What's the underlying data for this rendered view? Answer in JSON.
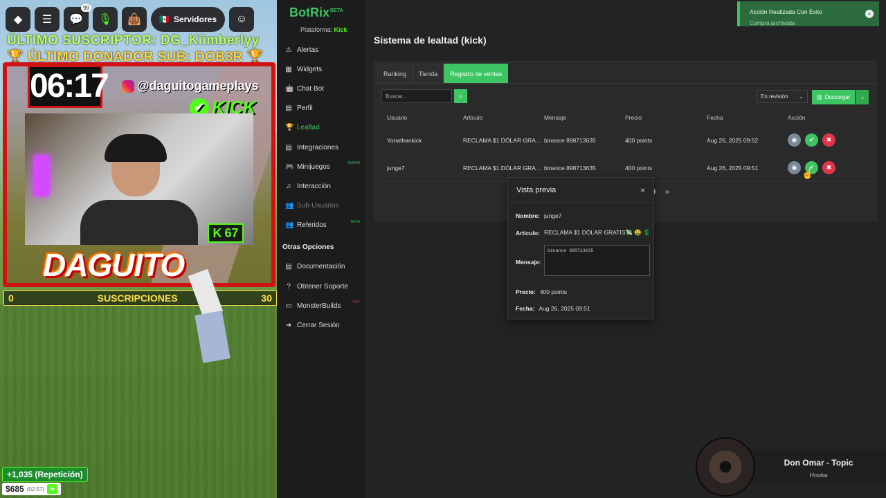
{
  "stream": {
    "topbar": {
      "chat_badge": "99",
      "servers_label": "Servidores"
    },
    "ticker_sub": "ÚLTIMO SUSCRIPTOR: DG_Kiimberlyy",
    "ticker_donor": "🏆 ÚLTIMO DONADOR SUB: DOB3R 🏆",
    "timer": "06:17",
    "instagram": "@daguitogameplays",
    "kick_label": "KICK",
    "kick_count": "67",
    "streamer_name": "DAGUITO",
    "sub_goal": {
      "label": "SUSCRIPCIONES",
      "start": "0",
      "end": "30"
    },
    "repeat": "+1,035 (Repetición)",
    "money": "$685",
    "money_time": "(02:57)",
    "money_plus": "+"
  },
  "app": {
    "logo": "BotRix",
    "logo_tag": "BETA",
    "platform_label": "Plataforma:",
    "platform_value": "Kick",
    "nav": [
      {
        "label": "Alertas",
        "icon": "⚠"
      },
      {
        "label": "Widgets",
        "icon": "▦"
      },
      {
        "label": "Chat Bot",
        "icon": "🤖"
      },
      {
        "label": "Perfil",
        "icon": "▤"
      },
      {
        "label": "Lealtad",
        "icon": "🏆"
      },
      {
        "label": "Integraciones",
        "icon": "▤"
      },
      {
        "label": "Minijuegos",
        "icon": "🎮",
        "tag": "NUEVO"
      },
      {
        "label": "Interacción",
        "icon": "♫"
      },
      {
        "label": "Sub-Usuarios",
        "icon": "👥"
      },
      {
        "label": "Referidos",
        "icon": "👥",
        "tag": "BETA"
      }
    ],
    "other_section": "Otras Opciones",
    "other_nav": [
      {
        "label": "Documentación",
        "icon": "▤"
      },
      {
        "label": "Obtener Soporte",
        "icon": "?"
      },
      {
        "label": "MonsterBuilds",
        "icon": "▭",
        "tag": "HOT"
      },
      {
        "label": "Cerrar Sesión",
        "icon": "➜"
      }
    ],
    "page_title": "Sistema de lealtad (kick)",
    "tabs": [
      "Ranking",
      "Tienda",
      "Registro de ventas"
    ],
    "search_placeholder": "Buscar...",
    "filter_value": "En revisión",
    "download_label": "Descargar",
    "columns": [
      "Usuario",
      "Articulo",
      "Mensaje",
      "Precio",
      "Fecha",
      "Acción"
    ],
    "rows": [
      {
        "user": "Yonathankick",
        "item": "RECLAMA $1 DÓLAR GRA...",
        "message": "binance 898713635",
        "price": "400 points",
        "date": "Aug 26, 2025 09:52"
      },
      {
        "user": "junge7",
        "item": "RECLAMA $1 DÓLAR GRA...",
        "message": "binance 898713635",
        "price": "400 points",
        "date": "Aug 26, 2025 09:51"
      }
    ],
    "pager": {
      "next": "»"
    },
    "modal": {
      "title": "Vista previa",
      "close": "×",
      "name_label": "Nombre:",
      "name_value": "junge7",
      "item_label": "Articulo:",
      "item_value": "RECLAMA $1 DÓLAR GRATIS💸 🤑 💲",
      "message_label": "Mensaje:",
      "message_value": "binance 898713635",
      "price_label": "Precio:",
      "price_value": "400 points",
      "date_label": "Fecha:",
      "date_value": "Aug 26, 2025 09:51"
    },
    "toast": {
      "title": "Acción Realizada Con Éxito",
      "subtitle": "Compra archivada"
    }
  },
  "music": {
    "artist": "Don Omar - Topic",
    "song": "Hooka"
  },
  "colors": {
    "accent": "#3cc562",
    "kick": "#53fc18",
    "danger": "#e0364b",
    "frame": "#d01212"
  }
}
